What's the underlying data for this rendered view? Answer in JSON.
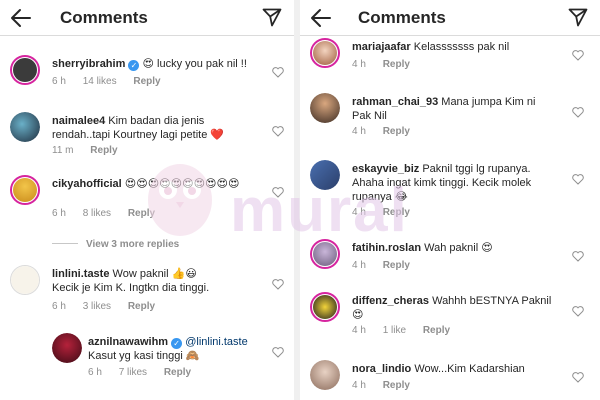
{
  "left": {
    "title": "Comments",
    "comments": [
      {
        "user": "sherryibrahim",
        "verified": true,
        "text_emoji": "😍",
        "text": " lucky you pak nil !!",
        "time": "6 h",
        "likes": "14 likes",
        "reply": "Reply"
      },
      {
        "user": "naimalee4",
        "text": "Kim badan dia jenis rendah..tapi Kourtney lagi petite",
        "text_emoji": "❤️",
        "time": "11 m",
        "reply": "Reply"
      },
      {
        "user": "cikyahofficial",
        "text_emoji": "😍😍😍😍😍😍😍😍😍😍",
        "time": "6 h",
        "likes": "8 likes",
        "reply": "Reply"
      },
      {
        "user": "linlini.taste",
        "text": "Wow paknil",
        "text_emoji": "👍😃",
        "text2": "Kecik je Kim K. Ingtkn dia tinggi.",
        "time": "6 h",
        "likes": "3 likes",
        "reply": "Reply"
      },
      {
        "user": "aznilnawawihm",
        "verified": true,
        "mention": "@linlini.taste",
        "text": "Kasut yg kasi tinggi",
        "text_emoji": "🙈",
        "time": "6 h",
        "likes": "7 likes",
        "reply": "Reply"
      }
    ],
    "view_more": "View 3 more replies"
  },
  "right": {
    "title": "Comments",
    "comments": [
      {
        "user": "mariajaafar",
        "text": "Kelasssssss pak nil",
        "time": "4 h",
        "reply": "Reply"
      },
      {
        "user": "rahman_chai_93",
        "text": "Mana jumpa Kim ni Pak Nil",
        "time": "4 h",
        "reply": "Reply"
      },
      {
        "user": "eskayvie_biz",
        "text": "Paknil tggi lg rupanya. Ahaha ingat kimk tinggi. Kecik molek rupanya",
        "text_emoji": "😂",
        "time": "4 h",
        "reply": "Reply"
      },
      {
        "user": "fatihin.roslan",
        "text": "Wah paknil",
        "text_emoji": "😍",
        "time": "4 h",
        "reply": "Reply"
      },
      {
        "user": "diffenz_cheras",
        "text": "Wahhh bESTNYA Paknil",
        "text_emoji": "😍",
        "time": "4 h",
        "likes": "1 like",
        "reply": "Reply"
      },
      {
        "user": "nora_lindio",
        "text": "Wow...Kim Kadarshian",
        "time": "4 h",
        "reply": "Reply"
      }
    ]
  },
  "watermark": "mural",
  "colors": {
    "story_ring": "#d6249f",
    "heart_red": "#ed4956",
    "verified": "#3897f0",
    "mention": "#00376b",
    "meta_grey": "#8e8e8e"
  }
}
